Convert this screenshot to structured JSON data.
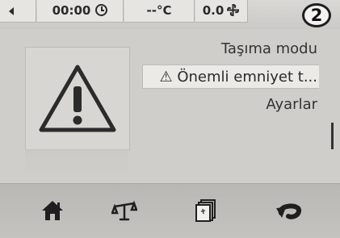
{
  "status_bar": {
    "time": "00:00",
    "temperature": "--°C",
    "fan": "0.0",
    "badge": "2",
    "icons": [
      "back-arrow-icon",
      "clock-icon",
      "fan-icon"
    ]
  },
  "warning_panel": {
    "icon": "warning-triangle-icon"
  },
  "menu": {
    "items": [
      {
        "label": "Taşıma modu",
        "selected": false
      },
      {
        "label": "⚠ Önemli emniyet t...",
        "selected": true
      },
      {
        "label": "Ayarlar",
        "selected": false
      }
    ]
  },
  "nav": {
    "icons": [
      "home-icon",
      "balance-scale-icon",
      "cards-icon",
      "return-arrow-icon"
    ]
  },
  "colors": {
    "background": "#cfcecb",
    "text": "#2a2a2a",
    "highlight": "#ebeae7"
  }
}
